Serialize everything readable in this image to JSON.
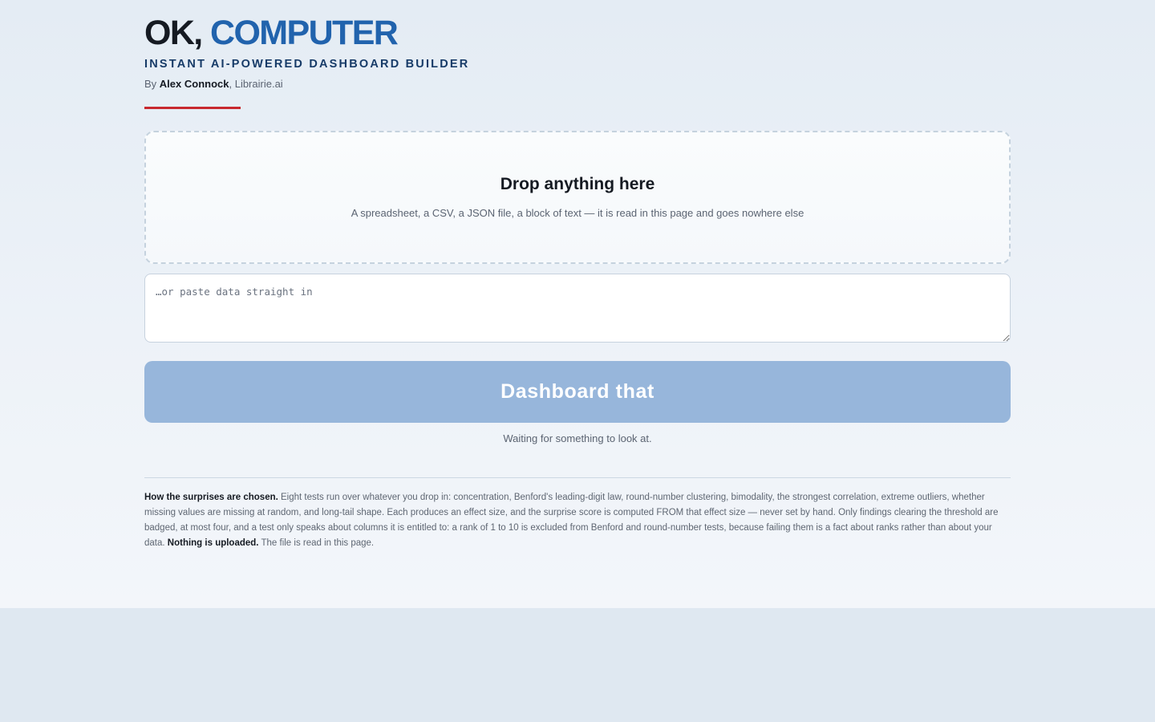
{
  "header": {
    "title_part1": "OK, ",
    "title_part2": "COMPUTER",
    "subtitle": "INSTANT AI-POWERED DASHBOARD BUILDER",
    "byline_prefix": "By ",
    "author": "Alex Connock",
    "byline_suffix": ", Librairie.ai",
    "accent_color": "#c8282e",
    "brand_color": "#2163ad"
  },
  "dropzone": {
    "title": "Drop anything here",
    "subtitle": "A spreadsheet, a CSV, a JSON file, a block of text — it is read in this page and goes nowhere else"
  },
  "paste": {
    "placeholder": "…or paste data straight in",
    "value": ""
  },
  "action": {
    "button_label": "Dashboard that",
    "button_color": "#97b6db",
    "status": "Waiting for something to look at."
  },
  "footer_note": {
    "heading": "How the surprises are chosen.",
    "body": " Eight tests run over whatever you drop in: concentration, Benford's leading-digit law, round-number clustering, bimodality, the strongest correlation, extreme outliers, whether missing values are missing at random, and long-tail shape. Each produces an effect size, and the surprise score is computed FROM that effect size — never set by hand. Only findings clearing the threshold are badged, at most four, and a test only speaks about columns it is entitled to: a rank of 1 to 10 is excluded from Benford and round-number tests, because failing them is a fact about ranks rather than about your data. ",
    "emphasis": "Nothing is uploaded.",
    "tail": " The file is read in this page."
  }
}
